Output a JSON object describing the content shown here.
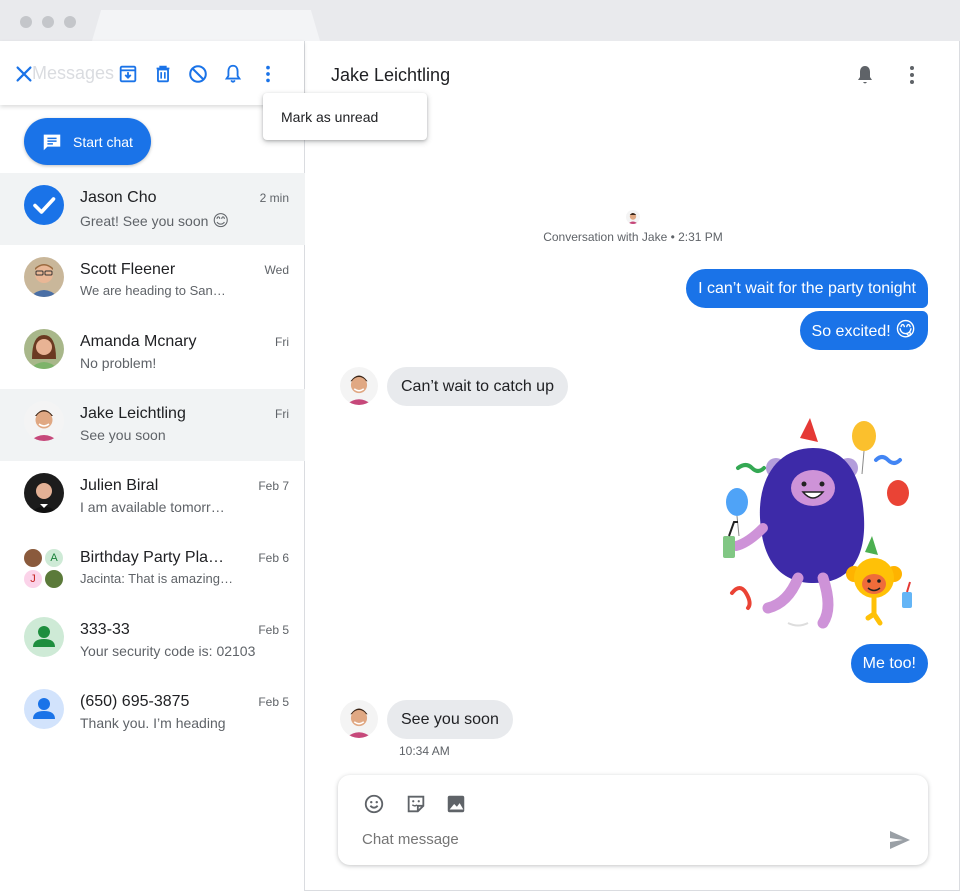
{
  "app": {
    "ghost_title": "Messages"
  },
  "toolbar": {
    "icons": [
      "close-icon",
      "archive-icon",
      "delete-icon",
      "block-icon",
      "notifications-icon",
      "more-vert-icon"
    ]
  },
  "menu": {
    "mark_unread": "Mark as unread"
  },
  "start_chat": {
    "label": "Start chat"
  },
  "conversations": [
    {
      "name": "Jason Cho",
      "snippet": "Great! See you soon",
      "time": "2 min",
      "emoji": "😊",
      "selected": true
    },
    {
      "name": "Scott Fleener",
      "snippet": "We are heading to San…",
      "time": "Wed"
    },
    {
      "name": "Amanda Mcnary",
      "snippet": "No problem!",
      "time": "Fri"
    },
    {
      "name": "Jake Leichtling",
      "snippet": "See you soon",
      "time": "Fri",
      "active": true
    },
    {
      "name": "Julien Biral",
      "snippet": "I am available tomorr…",
      "time": "Feb 7"
    },
    {
      "name": "Birthday Party Pla…",
      "snippet": "Jacinta: That is amazing…",
      "time": "Feb 6",
      "group_initials": [
        "A",
        "J"
      ]
    },
    {
      "name": "333-33",
      "snippet": "Your security code is: 02103",
      "time": "Feb 5"
    },
    {
      "name": "(650) 695-3875",
      "snippet": "Thank you. I’m heading",
      "time": "Feb 5"
    }
  ],
  "chat": {
    "title": "Jake Leichtling",
    "meta": "Conversation with Jake • 2:31 PM",
    "messages": [
      {
        "dir": "out",
        "text": "I can’t wait for the party tonight"
      },
      {
        "dir": "out",
        "text": "So excited!",
        "emoji": "😋"
      },
      {
        "dir": "in",
        "text": "Can’t wait to catch up"
      },
      {
        "dir": "out",
        "sticker": "party-monster-sticker"
      },
      {
        "dir": "out",
        "text": "Me too!"
      },
      {
        "dir": "in",
        "text": "See you soon",
        "time": "10:34 AM"
      }
    ]
  },
  "compose": {
    "placeholder": "Chat message"
  },
  "colors": {
    "accent": "#1a73e8",
    "incoming_bubble": "#e8eaed",
    "selected_row": "#f1f3f4"
  }
}
